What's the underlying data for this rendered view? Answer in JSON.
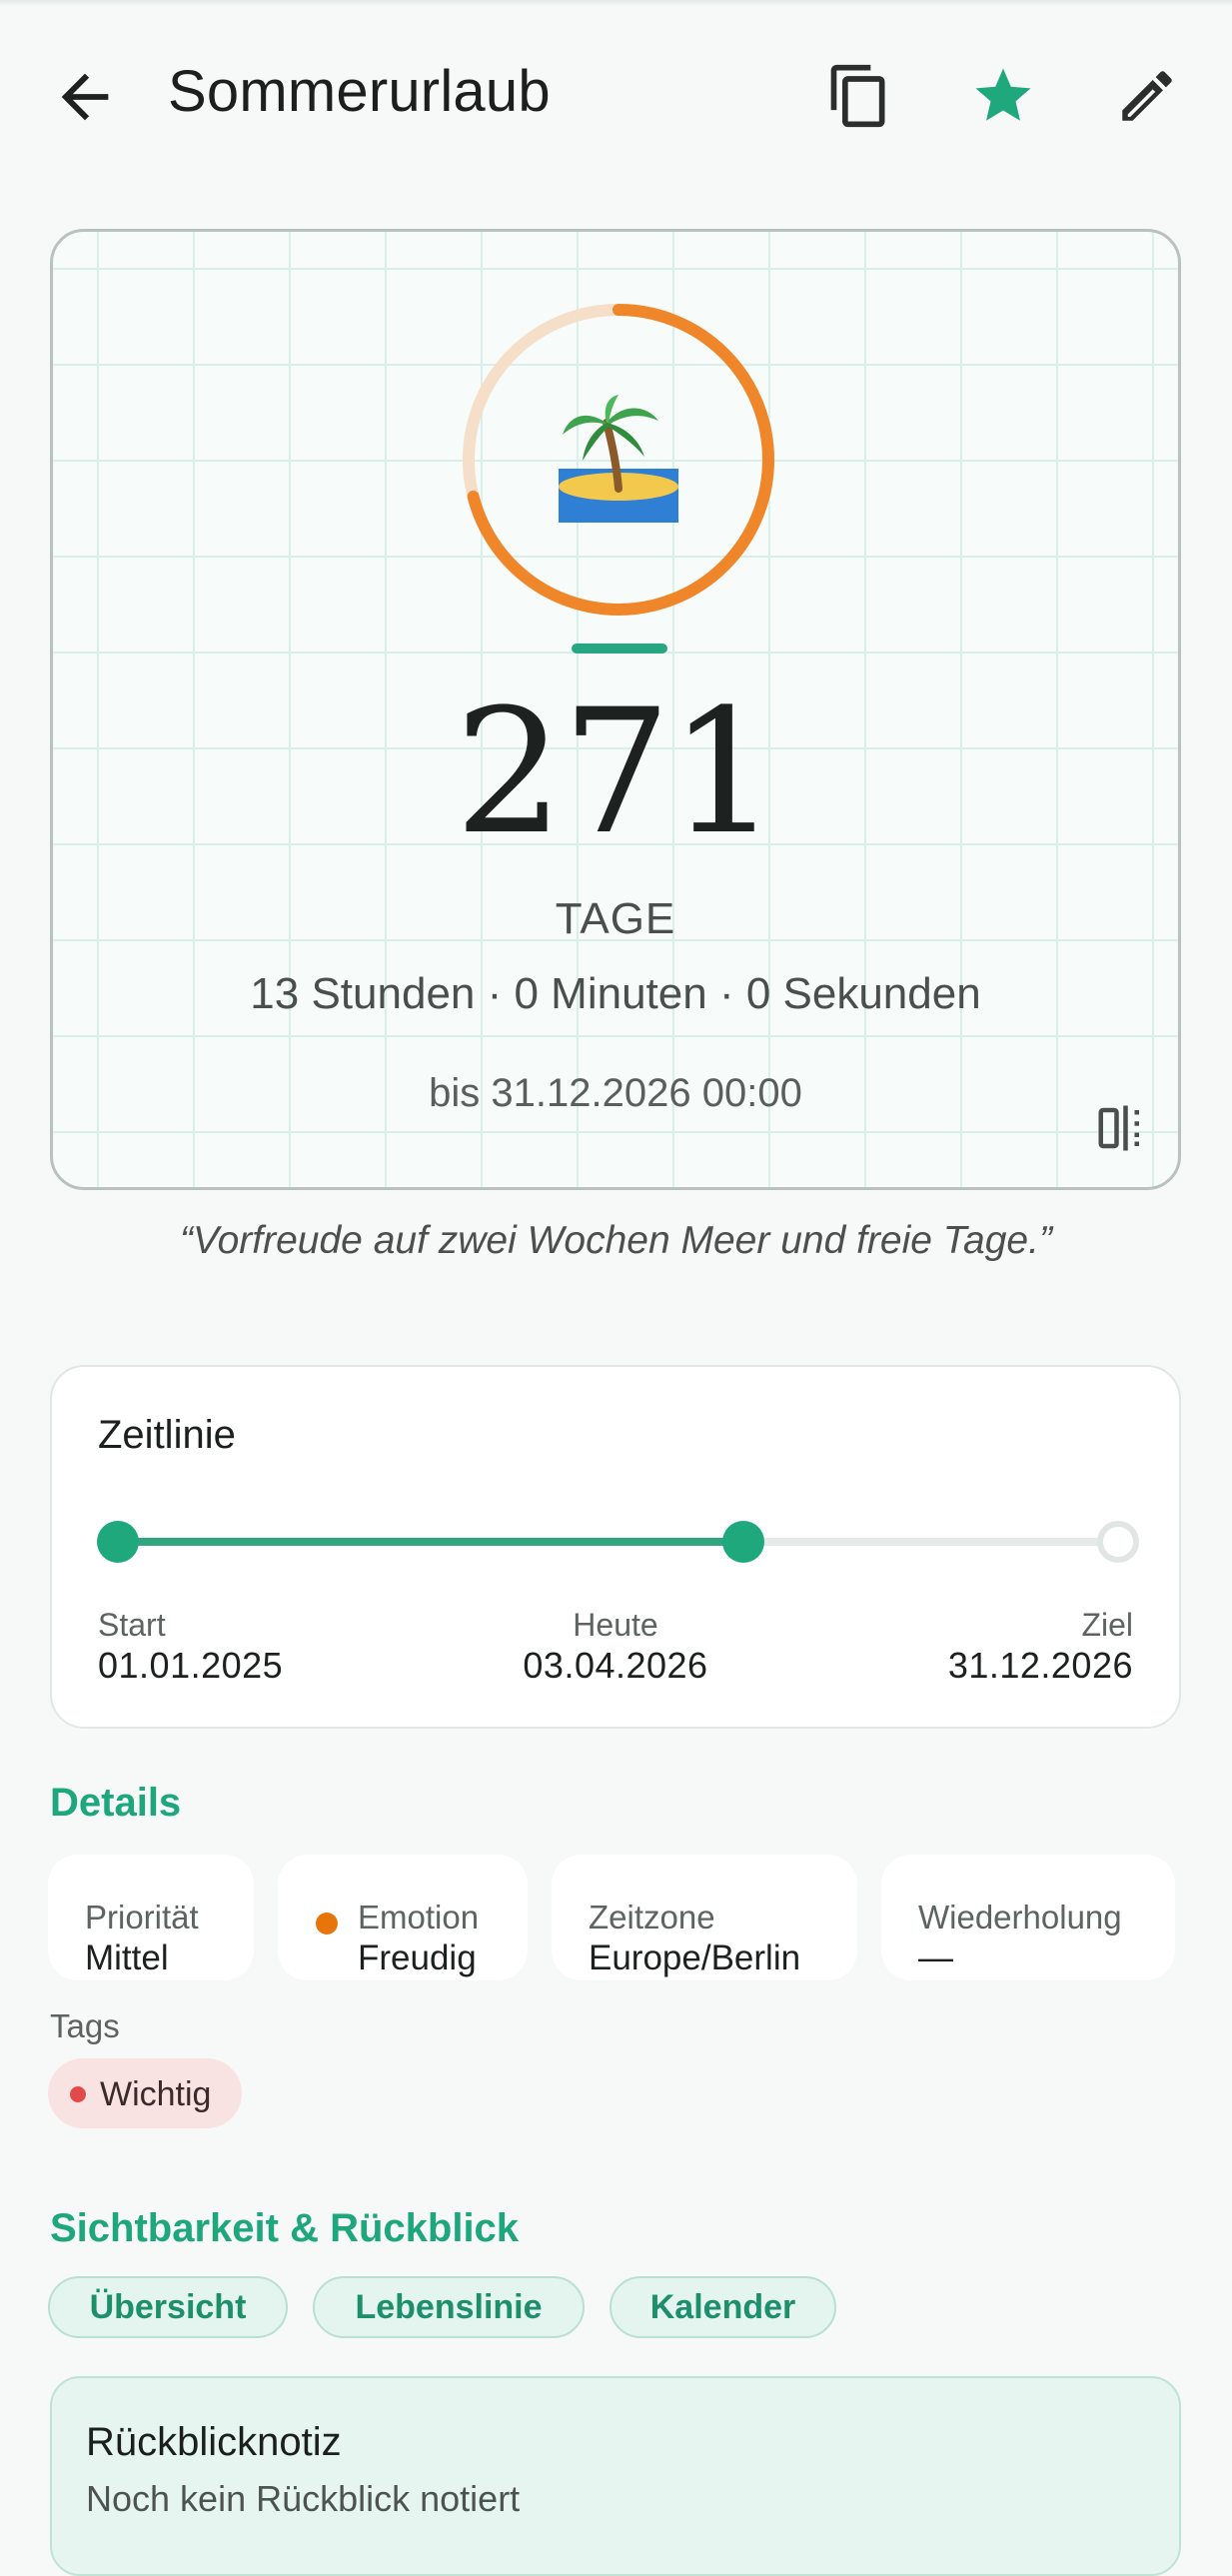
{
  "header": {
    "title": "Sommerurlaub",
    "icons": [
      "back-arrow-icon",
      "copy-icon",
      "star-icon",
      "edit-pencil-icon"
    ],
    "star_color": "#1fa87c"
  },
  "countdown": {
    "emoji": "🏝️",
    "days": "271",
    "unit": "TAGE",
    "rest": "13 Stunden · 0 Minuten · 0 Sekunden",
    "until": "bis 31.12.2026 00:00",
    "progress_fraction": 0.71,
    "ring_color": "#f0862a",
    "ring_track_color": "#f6dfc8"
  },
  "quote": "“Vorfreude auf zwei Wochen Meer und freie Tage.”",
  "timeline": {
    "title": "Zeitlinie",
    "progress_fraction": 0.6,
    "start": {
      "label": "Start",
      "value": "01.01.2025"
    },
    "today": {
      "label": "Heute",
      "value": "03.04.2026"
    },
    "goal": {
      "label": "Ziel",
      "value": "31.12.2026"
    }
  },
  "details": {
    "title": "Details",
    "chips": [
      {
        "label": "Priorität",
        "value": "Mittel"
      },
      {
        "label": "Emotion",
        "value": "Freudig",
        "dot_color": "#e8740c"
      },
      {
        "label": "Zeitzone",
        "value": "Europe/Berlin"
      },
      {
        "label": "Wiederholung",
        "value": "—"
      }
    ],
    "tags_label": "Tags",
    "tags": [
      {
        "label": "Wichtig",
        "color": "#e14a4a"
      }
    ]
  },
  "visibility": {
    "title": "Sichtbarkeit & Rückblick",
    "pills": [
      "Übersicht",
      "Lebenslinie",
      "Kalender"
    ]
  },
  "review": {
    "title": "Rückblicknotiz",
    "text": "Noch kein Rückblick notiert"
  }
}
